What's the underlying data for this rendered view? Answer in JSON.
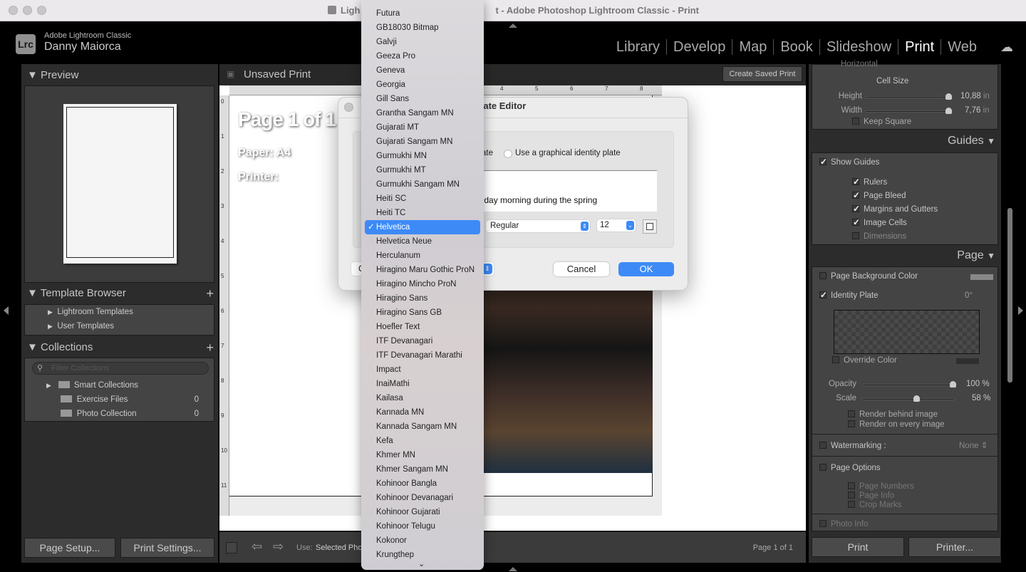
{
  "window": {
    "title_left": "Ligh",
    "title_right": "t - Adobe Photoshop Lightroom Classic - Print"
  },
  "identity": {
    "logo": "Lrc",
    "app": "Adobe Lightroom Classic",
    "user": "Danny Maiorca"
  },
  "modules": [
    "Library",
    "Develop",
    "Map",
    "Book",
    "Slideshow",
    "Print",
    "Web"
  ],
  "active_module": "Print",
  "left": {
    "preview": "Preview",
    "template_browser": {
      "title": "Template Browser",
      "items": [
        "Lightroom Templates",
        "User Templates"
      ]
    },
    "collections": {
      "title": "Collections",
      "filter_placeholder": "Filter Collections",
      "items": [
        {
          "name": "Smart Collections",
          "count": ""
        },
        {
          "name": "Exercise Files",
          "count": "0"
        },
        {
          "name": "Photo Collection",
          "count": "0"
        }
      ]
    },
    "page_setup": "Page Setup...",
    "print_settings": "Print Settings..."
  },
  "center": {
    "title": "Unsaved Print",
    "create_saved": "Create Saved Print",
    "page_info": {
      "page": "Page 1 of 1",
      "paper": "Paper:  A4",
      "printer": "Printer:"
    },
    "ruler_top": [
      "4",
      "5",
      "6",
      "7",
      "8"
    ],
    "ruler_left": [
      "0",
      "1",
      "2",
      "3",
      "4",
      "5",
      "6",
      "7",
      "8",
      "9",
      "10",
      "11"
    ],
    "toolbar": {
      "use_label": "Use:",
      "use_value": "Selected Pho",
      "page_count": "Page 1 of 1"
    }
  },
  "dialog": {
    "title": "ntity Plate Editor",
    "radio_partial": "ate",
    "radio_graphical": "Use a graphical identity plate",
    "text_value": "n Sunday morning during the spring",
    "style": "Regular",
    "size": "12",
    "left_btn_partial": "C",
    "cancel": "Cancel",
    "ok": "OK"
  },
  "font_menu": {
    "items": [
      "Futura",
      "GB18030 Bitmap",
      "Galvji",
      "Geeza Pro",
      "Geneva",
      "Georgia",
      "Gill Sans",
      "Grantha Sangam MN",
      "Gujarati MT",
      "Gujarati Sangam MN",
      "Gurmukhi MN",
      "Gurmukhi MT",
      "Gurmukhi Sangam MN",
      "Heiti SC",
      "Heiti TC",
      "Helvetica",
      "Helvetica Neue",
      "Herculanum",
      "Hiragino Maru Gothic ProN",
      "Hiragino Mincho ProN",
      "Hiragino Sans",
      "Hiragino Sans GB",
      "Hoefler Text",
      "ITF Devanagari",
      "ITF Devanagari Marathi",
      "Impact",
      "InaiMathi",
      "Kailasa",
      "Kannada MN",
      "Kannada Sangam MN",
      "Kefa",
      "Khmer MN",
      "Khmer Sangam MN",
      "Kohinoor Bangla",
      "Kohinoor Devanagari",
      "Kohinoor Gujarati",
      "Kohinoor Telugu",
      "Kokonor",
      "Krungthep"
    ],
    "selected": "Helvetica"
  },
  "right": {
    "horizontal_partial": "Horizontal",
    "cell_size": {
      "title": "Cell Size",
      "height_label": "Height",
      "height": "10,88",
      "width_label": "Width",
      "width": "7,76",
      "unit": "in",
      "keep_square": "Keep Square",
      "height_frac": 0.98,
      "width_frac": 0.98
    },
    "guides": {
      "title": "Guides",
      "show": "Show Guides",
      "items": [
        {
          "label": "Rulers",
          "on": true
        },
        {
          "label": "Page Bleed",
          "on": true
        },
        {
          "label": "Margins and Gutters",
          "on": true
        },
        {
          "label": "Image Cells",
          "on": true
        },
        {
          "label": "Dimensions",
          "on": false
        }
      ]
    },
    "page": {
      "title": "Page",
      "bg_color": "Page Background Color",
      "identity_plate": "Identity Plate",
      "angle": "0°",
      "override": "Override Color",
      "opacity_label": "Opacity",
      "opacity": "100 %",
      "opacity_value": 100,
      "scale_label": "Scale",
      "scale": "58 %",
      "scale_value": 58,
      "render_behind": "Render behind image",
      "render_every": "Render on every image",
      "watermarking": "Watermarking :",
      "watermark_value": "None",
      "page_options": "Page Options",
      "options": [
        "Page Numbers",
        "Page Info",
        "Crop Marks"
      ],
      "photo_info": "Photo Info"
    },
    "print": "Print",
    "printer": "Printer..."
  },
  "colors": {
    "accent": "#3d8af7",
    "panel": "#3a3a3a"
  }
}
